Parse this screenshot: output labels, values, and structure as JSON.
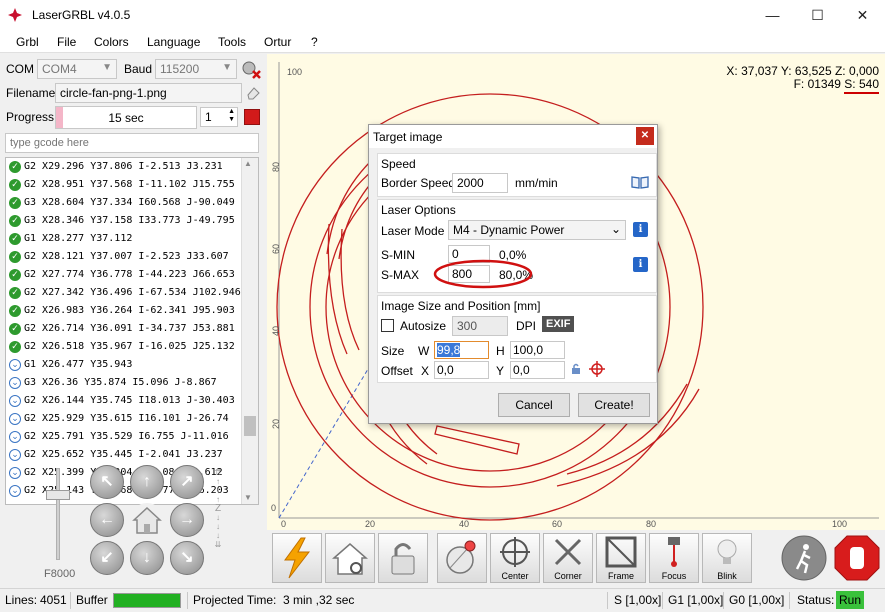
{
  "window": {
    "title": "LaserGRBL v4.0.5"
  },
  "menu": [
    "Grbl",
    "File",
    "Colors",
    "Language",
    "Tools",
    "Ortur",
    "?"
  ],
  "connection": {
    "com_label": "COM",
    "com_value": "COM4",
    "baud_label": "Baud",
    "baud_value": "115200"
  },
  "file": {
    "label": "Filename",
    "value": "circle-fan-png-1.png"
  },
  "progress": {
    "label": "Progress",
    "time": "15 sec",
    "copies": "1",
    "fraction": 0.05
  },
  "command_input": {
    "placeholder": "type gcode here"
  },
  "gcode_lines": [
    {
      "text": "G2 X29.296 Y37.806 I-2.513 J3.231",
      "status": "ok"
    },
    {
      "text": "G2 X28.951 Y37.568 I-11.102 J15.755",
      "status": "ok"
    },
    {
      "text": "G3 X28.604 Y37.334 I60.568 J-90.049",
      "status": "ok"
    },
    {
      "text": "G3 X28.346 Y37.158 I33.773 J-49.795",
      "status": "ok"
    },
    {
      "text": "G1 X28.277 Y37.112",
      "status": "ok"
    },
    {
      "text": "G2 X28.121 Y37.007 I-2.523 J33.607",
      "status": "ok"
    },
    {
      "text": "G2 X27.774 Y36.778 I-44.223 J66.653",
      "status": "ok"
    },
    {
      "text": "G2 X27.342 Y36.496 I-67.534 J102.946",
      "status": "ok"
    },
    {
      "text": "G2 X26.983 Y36.264 I-62.341 J95.903",
      "status": "ok"
    },
    {
      "text": "G2 X26.714 Y36.091 I-34.737 J53.881",
      "status": "ok"
    },
    {
      "text": "G2 X26.518 Y35.967 I-16.025 J25.132",
      "status": "ok"
    },
    {
      "text": "G1 X26.477 Y35.943",
      "status": "queued"
    },
    {
      "text": "G3 X26.36 Y35.874 I5.096 J-8.867",
      "status": "queued"
    },
    {
      "text": "G2 X26.144 Y35.745 I18.013 J-30.403",
      "status": "queued"
    },
    {
      "text": "G2 X25.929 Y35.615 I16.101 J-26.74",
      "status": "queued"
    },
    {
      "text": "G2 X25.791 Y35.529 I6.755 J-11.016",
      "status": "queued"
    },
    {
      "text": "G2 X25.652 Y35.445 I-2.041 J3.237",
      "status": "queued"
    },
    {
      "text": "G2 X25.399 Y35.304 I-6.08 J10.612",
      "status": "queued"
    },
    {
      "text": "G2 X25.143 Y35.168 I-8.779 J16.203",
      "status": "queued"
    }
  ],
  "jog": {
    "feed": "F8000",
    "z_label": "Z",
    "home_icon": "home-icon"
  },
  "canvas": {
    "coords": "X: 37,037 Y: 63,525 Z: 0,000",
    "feed": "F: 01349",
    "power": "S: 540",
    "y_ticks": [
      "100",
      "80",
      "60",
      "40",
      "20",
      "0"
    ],
    "x_ticks": [
      "0",
      "20",
      "40",
      "60",
      "80",
      "100"
    ],
    "highlight_color": "#cc0000"
  },
  "toolbar": {
    "center": "Center",
    "corner": "Corner",
    "frame": "Frame",
    "focus": "Focus",
    "blink": "Blink"
  },
  "status": {
    "lines_label": "Lines:",
    "lines_value": "4051",
    "buffer_label": "Buffer",
    "projected": "Projected Time:",
    "projected_value": "3 min ,32 sec",
    "s_override": "S [1,00x]",
    "g1_override": "G1 [1,00x]",
    "g0_override": "G0 [1,00x]",
    "status_label": "Status:",
    "status_value": "Run"
  },
  "dialog": {
    "title": "Target image",
    "speed_group": "Speed",
    "border_speed_label": "Border Speed",
    "border_speed_value": "2000",
    "border_speed_unit": "mm/min",
    "laser_group": "Laser Options",
    "laser_mode_label": "Laser Mode",
    "laser_mode_value": "M4 - Dynamic Power",
    "smin_label": "S-MIN",
    "smin_value": "0",
    "smin_pct": "0,0%",
    "smax_label": "S-MAX",
    "smax_value": "800",
    "smax_pct": "80,0%",
    "size_group": "Image Size and Position [mm]",
    "autosize_label": "Autosize",
    "dpi_value": "300",
    "dpi_label": "DPI",
    "exif": "EXIF",
    "size_label": "Size",
    "w_label": "W",
    "w_value": "99,8",
    "h_label": "H",
    "h_value": "100,0",
    "offset_label": "Offset",
    "x_label": "X",
    "x_value": "0,0",
    "y_label": "Y",
    "y_value": "0,0",
    "cancel": "Cancel",
    "create": "Create!"
  }
}
